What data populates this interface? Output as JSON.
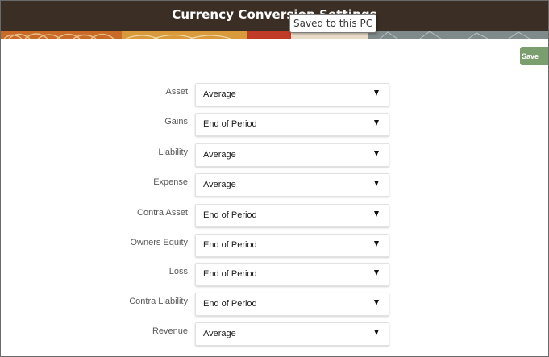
{
  "header": {
    "title": "Currency Conversion Settings",
    "tooltip": "Saved to this PC"
  },
  "toolbar": {
    "save_label": "Save",
    "save_color": "#7b9e6e"
  },
  "form": {
    "rows": [
      {
        "label": "Asset",
        "value": "Average"
      },
      {
        "label": "Gains",
        "value": "End of Period"
      },
      {
        "label": "Liability",
        "value": "Average"
      },
      {
        "label": "Expense",
        "value": "Average"
      },
      {
        "label": "Contra Asset",
        "value": "End of Period"
      },
      {
        "label": "Owners Equity",
        "value": "End of Period"
      },
      {
        "label": "Loss",
        "value": "End of Period"
      },
      {
        "label": "Contra Liability",
        "value": "End of Period"
      },
      {
        "label": "Revenue",
        "value": "Average"
      }
    ]
  },
  "icons": {
    "dropdown": "caret-down-icon"
  },
  "colors": {
    "header_bar": "#3b2f25"
  }
}
